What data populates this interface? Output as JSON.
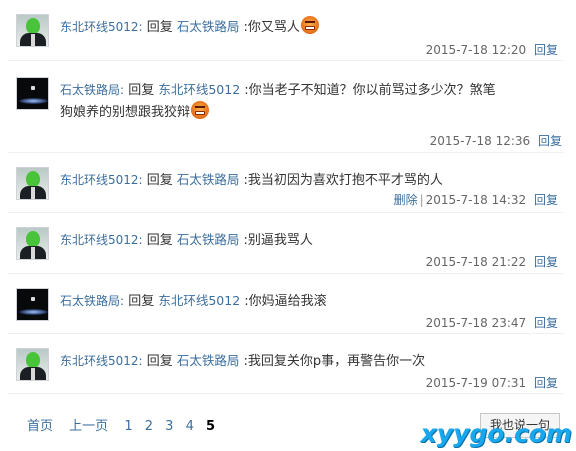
{
  "comments": [
    {
      "user": "东北环线5012:",
      "reply_word": "回复",
      "target": "石太铁路局",
      "text": ":你又骂人",
      "emoji": true,
      "date": "2015-7-18 12:20",
      "delete": "",
      "reply": "回复",
      "avatar": "green-face"
    },
    {
      "user": "石太铁路局:",
      "reply_word": "回复",
      "target": "东北环线5012",
      "text": ":你当老子不知道？你以前骂过多少次？煞笔狗娘养的别想跟我狡辩",
      "emoji": true,
      "date": "2015-7-18 12:36",
      "delete": "",
      "reply": "回复",
      "avatar": "dark"
    },
    {
      "user": "东北环线5012:",
      "reply_word": "回复",
      "target": "石太铁路局",
      "text": ":我当初因为喜欢打抱不平才骂的人",
      "emoji": false,
      "date": "2015-7-18 14:32",
      "delete": "删除",
      "reply": "回复",
      "avatar": "green-face"
    },
    {
      "user": "东北环线5012:",
      "reply_word": "回复",
      "target": "石太铁路局",
      "text": ":别逼我骂人",
      "emoji": false,
      "date": "2015-7-18 21:22",
      "delete": "",
      "reply": "回复",
      "avatar": "green-face"
    },
    {
      "user": "石太铁路局:",
      "reply_word": "回复",
      "target": "东北环线5012",
      "text": ":你妈逼给我滚",
      "emoji": false,
      "date": "2015-7-18 23:47",
      "delete": "",
      "reply": "回复",
      "avatar": "dark"
    },
    {
      "user": "东北环线5012:",
      "reply_word": "回复",
      "target": "石太铁路局",
      "text": ":我回复关你p事，再警告你一次",
      "emoji": false,
      "date": "2015-7-19 07:31",
      "delete": "",
      "reply": "回复",
      "avatar": "green-face"
    }
  ],
  "pager": {
    "first": "首页",
    "prev": "上一页",
    "pages": [
      "1",
      "2",
      "3",
      "4",
      "5"
    ],
    "current": "5"
  },
  "say_button": "我也说一句",
  "watermark": "xyygo.com",
  "colors": {
    "link": "#3b6e9e",
    "watermark": "#19a8ee"
  }
}
